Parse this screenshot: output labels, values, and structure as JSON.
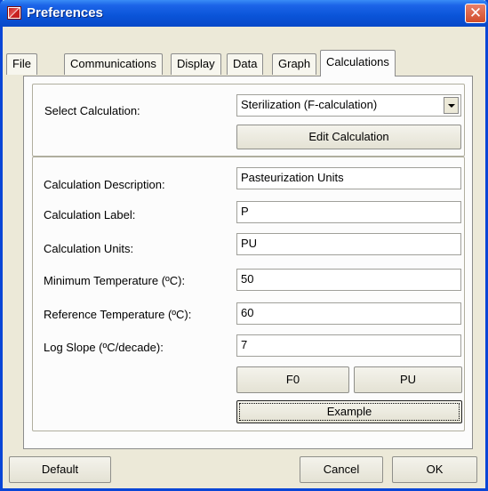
{
  "window": {
    "title": "Preferences"
  },
  "tabs": [
    {
      "label": "File"
    },
    {
      "label": "Communications"
    },
    {
      "label": "Display"
    },
    {
      "label": "Data"
    },
    {
      "label": "Graph"
    },
    {
      "label": "Calculations",
      "active": true
    }
  ],
  "calc": {
    "select_label": "Select Calculation:",
    "select_value": "Sterilization (F-calculation)",
    "edit_button": "Edit Calculation",
    "fields": [
      {
        "label": "Calculation Description:",
        "value": "Pasteurization Units"
      },
      {
        "label": "Calculation Label:",
        "value": "P"
      },
      {
        "label": "Calculation Units:",
        "value": "PU"
      },
      {
        "label": "Minimum Temperature (ºC):",
        "value": "50"
      },
      {
        "label": "Reference Temperature (ºC):",
        "value": "60"
      },
      {
        "label": "Log Slope (ºC/decade):",
        "value": "7"
      }
    ],
    "f0_button": "F0",
    "pu_button": "PU",
    "example_button": "Example"
  },
  "footer": {
    "default_button": "Default",
    "cancel_button": "Cancel",
    "ok_button": "OK"
  }
}
